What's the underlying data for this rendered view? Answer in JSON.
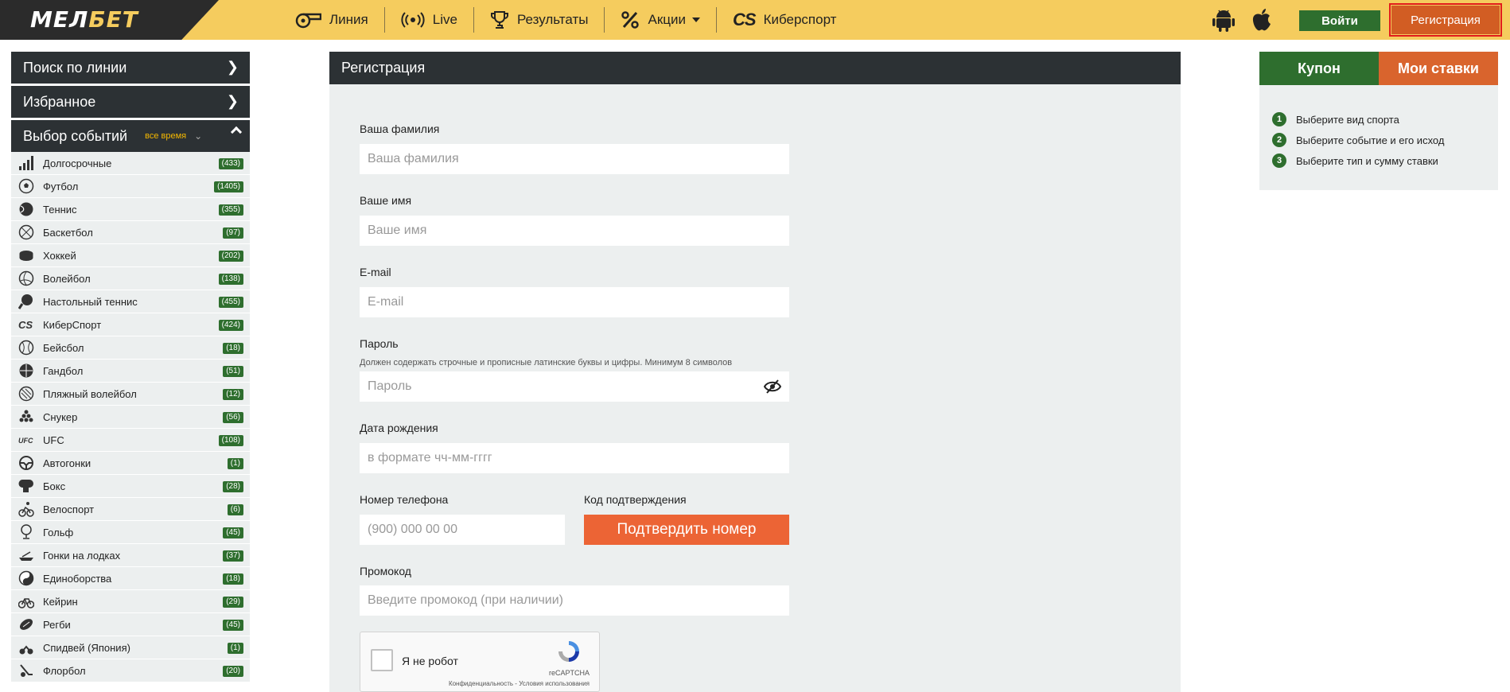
{
  "header": {
    "logo_main": "МЕЛ",
    "logo_accent": "БЕТ",
    "nav": [
      {
        "label": "Линия",
        "icon": "whistle-icon"
      },
      {
        "label": "Live",
        "icon": "broadcast-icon"
      },
      {
        "label": "Результаты",
        "icon": "trophy-icon"
      },
      {
        "label": "Акции",
        "icon": "percent-icon"
      },
      {
        "label": "Киберспорт",
        "icon": "cs-icon"
      }
    ],
    "cs_glyph": "CS",
    "login_label": "Войти",
    "register_label": "Регистрация"
  },
  "sidebar": {
    "search_line": "Поиск по линии",
    "favorites": "Избранное",
    "events_title": "Выбор событий",
    "all_time": "все время",
    "sports": [
      {
        "name": "Долгосрочные",
        "count": "(433)",
        "icon": "chart-bars-icon"
      },
      {
        "name": "Футбол",
        "count": "(1405)",
        "icon": "soccer-ball-icon"
      },
      {
        "name": "Теннис",
        "count": "(355)",
        "icon": "tennis-ball-icon"
      },
      {
        "name": "Баскетбол",
        "count": "(97)",
        "icon": "basketball-icon"
      },
      {
        "name": "Хоккей",
        "count": "(202)",
        "icon": "hockey-puck-icon"
      },
      {
        "name": "Волейбол",
        "count": "(138)",
        "icon": "volleyball-icon"
      },
      {
        "name": "Настольный теннис",
        "count": "(455)",
        "icon": "ping-pong-icon"
      },
      {
        "name": "КиберСпорт",
        "count": "(424)",
        "icon": "cs-icon"
      },
      {
        "name": "Бейсбол",
        "count": "(18)",
        "icon": "baseball-icon"
      },
      {
        "name": "Гандбол",
        "count": "(51)",
        "icon": "handball-icon"
      },
      {
        "name": "Пляжный волейбол",
        "count": "(12)",
        "icon": "beach-volleyball-icon"
      },
      {
        "name": "Снукер",
        "count": "(56)",
        "icon": "snooker-icon"
      },
      {
        "name": "UFC",
        "count": "(108)",
        "icon": "ufc-icon"
      },
      {
        "name": "Автогонки",
        "count": "(1)",
        "icon": "steering-wheel-icon"
      },
      {
        "name": "Бокс",
        "count": "(28)",
        "icon": "boxing-glove-icon"
      },
      {
        "name": "Велоспорт",
        "count": "(6)",
        "icon": "cyclist-icon"
      },
      {
        "name": "Гольф",
        "count": "(45)",
        "icon": "golf-icon"
      },
      {
        "name": "Гонки на лодках",
        "count": "(37)",
        "icon": "boat-icon"
      },
      {
        "name": "Единоборства",
        "count": "(18)",
        "icon": "yin-yang-icon"
      },
      {
        "name": "Кейрин",
        "count": "(29)",
        "icon": "bicycle-icon"
      },
      {
        "name": "Регби",
        "count": "(45)",
        "icon": "rugby-ball-icon"
      },
      {
        "name": "Спидвей (Япония)",
        "count": "(1)",
        "icon": "speedway-icon"
      },
      {
        "name": "Флорбол",
        "count": "(20)",
        "icon": "floorball-icon"
      }
    ],
    "ufc_glyph": "UFC"
  },
  "form": {
    "title": "Регистрация",
    "surname_label": "Ваша фамилия",
    "surname_placeholder": "Ваша фамилия",
    "name_label": "Ваше имя",
    "name_placeholder": "Ваше имя",
    "email_label": "E-mail",
    "email_placeholder": "E-mail",
    "password_label": "Пароль",
    "password_hint": "Должен содержать строчные и прописные латинские буквы и цифры. Минимум 8 символов",
    "password_placeholder": "Пароль",
    "birth_label": "Дата рождения",
    "birth_placeholder": "в формате чч-мм-гггг",
    "phone_label": "Номер телефона",
    "phone_placeholder": "(900) 000 00 00",
    "code_label": "Код подтверждения",
    "confirm_label": "Подтвердить номер",
    "promo_label": "Промокод",
    "promo_placeholder": "Введите промокод (при наличии)",
    "captcha_label": "Я не робот",
    "captcha_brand": "reCAPTCHA",
    "captcha_links": "Конфиденциальность - Условия использования"
  },
  "coupon": {
    "tab_coupon": "Купон",
    "tab_bets": "Мои ставки",
    "steps": [
      {
        "num": "1",
        "text": "Выберите вид спорта"
      },
      {
        "num": "2",
        "text": "Выберите событие и его исход"
      },
      {
        "num": "3",
        "text": "Выберите тип и сумму ставки"
      }
    ]
  },
  "colors": {
    "header_bg": "#f5cc5e",
    "dark": "#2c3134",
    "green": "#2e6e2e",
    "orange": "#ec6435",
    "register": "#d25d23"
  }
}
